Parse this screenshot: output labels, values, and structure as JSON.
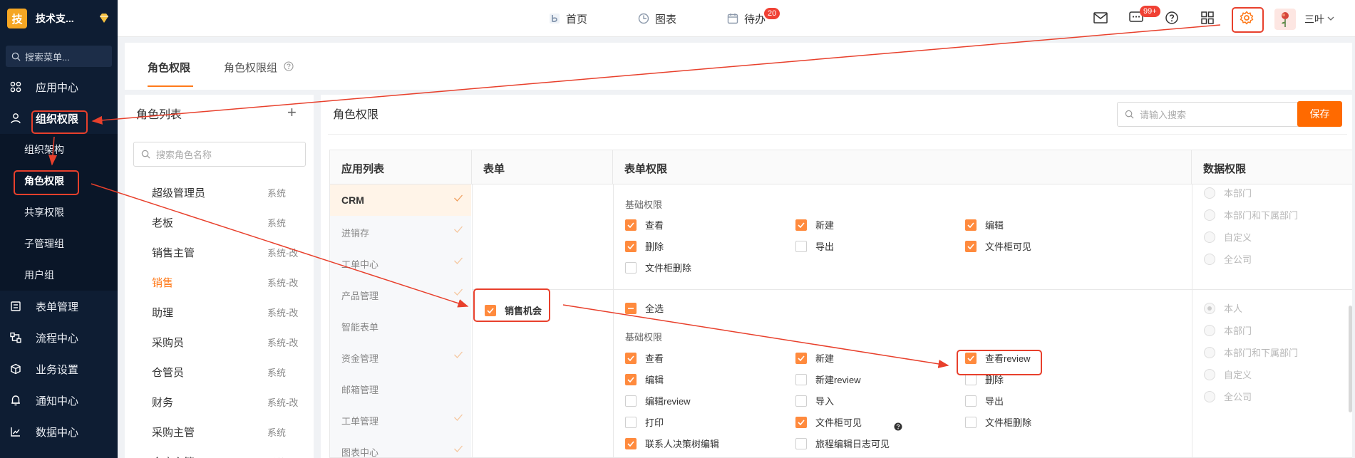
{
  "sidebar": {
    "logo_char": "技",
    "logo_text": "技术支...",
    "search_text": "搜索菜单...",
    "items": [
      {
        "label": "应用中心"
      },
      {
        "label": "组织权限"
      },
      {
        "label": "表单管理"
      },
      {
        "label": "流程中心"
      },
      {
        "label": "业务设置"
      },
      {
        "label": "通知中心"
      },
      {
        "label": "数据中心"
      }
    ],
    "sub_items": [
      {
        "label": "组织架构"
      },
      {
        "label": "角色权限"
      },
      {
        "label": "共享权限"
      },
      {
        "label": "子管理组"
      },
      {
        "label": "用户组"
      }
    ]
  },
  "header": {
    "nav": [
      {
        "label": "首页"
      },
      {
        "label": "图表"
      },
      {
        "label": "待办"
      }
    ],
    "todo_badge": "20",
    "message_badge": "99+",
    "user_name": "三叶"
  },
  "tabs": [
    {
      "label": "角色权限"
    },
    {
      "label": "角色权限组"
    }
  ],
  "role_panel": {
    "title": "角色列表",
    "plus": "+",
    "search_placeholder": "搜索角色名称",
    "roles": [
      {
        "name": "超级管理员",
        "tag": "系统"
      },
      {
        "name": "老板",
        "tag": "系统"
      },
      {
        "name": "销售主管",
        "tag": "系统-改"
      },
      {
        "name": "销售",
        "tag": "系统-改"
      },
      {
        "name": "助理",
        "tag": "系统-改"
      },
      {
        "name": "采购员",
        "tag": "系统-改"
      },
      {
        "name": "仓管员",
        "tag": "系统"
      },
      {
        "name": "财务",
        "tag": "系统-改"
      },
      {
        "name": "采购主管",
        "tag": "系统"
      },
      {
        "name": "仓库主管",
        "tag": "系统"
      }
    ]
  },
  "main": {
    "title": "角色权限",
    "search_placeholder": "请输入搜索",
    "save_label": "保存",
    "columns": {
      "app_list": "应用列表",
      "form": "表单",
      "form_perm": "表单权限",
      "data_perm": "数据权限"
    },
    "apps": [
      {
        "name": "CRM"
      },
      {
        "name": "进销存"
      },
      {
        "name": "工单中心"
      },
      {
        "name": "产品管理"
      },
      {
        "name": "智能表单"
      },
      {
        "name": "资金管理"
      },
      {
        "name": "邮箱管理"
      },
      {
        "name": "工单管理"
      },
      {
        "name": "图表中心"
      }
    ],
    "row1": {
      "section_label": "基础权限",
      "perms": [
        {
          "label": "查看",
          "checked": true
        },
        {
          "label": "新建",
          "checked": true
        },
        {
          "label": "编辑",
          "checked": true
        },
        {
          "label": "删除",
          "checked": true
        },
        {
          "label": "导出",
          "checked": false
        },
        {
          "label": "文件柜可见",
          "checked": true
        },
        {
          "label": "文件柜删除",
          "checked": false
        }
      ],
      "data_scope": [
        {
          "label": "本部门"
        },
        {
          "label": "本部门和下属部门"
        },
        {
          "label": "自定义"
        },
        {
          "label": "全公司"
        }
      ]
    },
    "row2": {
      "form_name": "销售机会",
      "select_all": "全选",
      "section_label": "基础权限",
      "perms": [
        {
          "label": "查看",
          "checked": true
        },
        {
          "label": "新建",
          "checked": true
        },
        {
          "label": "查看review",
          "checked": true
        },
        {
          "label": "编辑",
          "checked": true
        },
        {
          "label": "新建review",
          "checked": false
        },
        {
          "label": "删除",
          "checked": false
        },
        {
          "label": "编辑review",
          "checked": false
        },
        {
          "label": "导入",
          "checked": false
        },
        {
          "label": "导出",
          "checked": false
        },
        {
          "label": "打印",
          "checked": false
        },
        {
          "label": "文件柜可见",
          "checked": true
        },
        {
          "label": "文件柜删除",
          "checked": false
        },
        {
          "label": "联系人决策树编辑",
          "checked": true
        },
        {
          "label": "旅程编辑日志可见",
          "checked": false
        }
      ],
      "data_scope": [
        {
          "label": "本人"
        },
        {
          "label": "本部门"
        },
        {
          "label": "本部门和下属部门"
        },
        {
          "label": "自定义"
        },
        {
          "label": "全公司"
        }
      ]
    }
  },
  "colors": {
    "accent": "#ff6a00",
    "sidebar_bg": "#0e1d33",
    "annotation": "#e8402c"
  }
}
